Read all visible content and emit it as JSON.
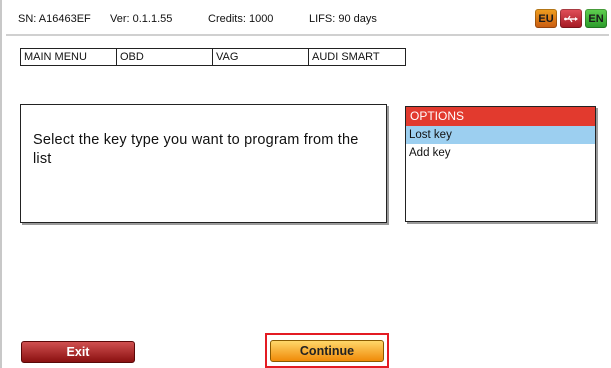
{
  "status": {
    "sn": "SN: A16463EF",
    "version": "Ver: 0.1.1.55",
    "credits": "Credits: 1000",
    "lifs": "LIFS: 90 days",
    "flags": [
      {
        "label": "EU",
        "color": "#e07a18"
      },
      {
        "label": "",
        "icon": "usb-icon",
        "color": "#c0202a"
      },
      {
        "label": "EN",
        "color": "#3fb83f"
      }
    ]
  },
  "breadcrumb": [
    "MAIN MENU",
    "OBD",
    "VAG",
    "AUDI SMART"
  ],
  "message": "Select the key type you want to program from the list",
  "options": {
    "title": "OPTIONS",
    "items": [
      "Lost key",
      "Add key"
    ],
    "selected_index": 0
  },
  "buttons": {
    "exit": "Exit",
    "continue": "Continue"
  },
  "colors": {
    "options_header": "#e23a2e",
    "selected_row": "#9ccff0",
    "exit_button": "#a01818",
    "continue_button": "#f5a21a",
    "highlight_frame": "#e31b23"
  }
}
